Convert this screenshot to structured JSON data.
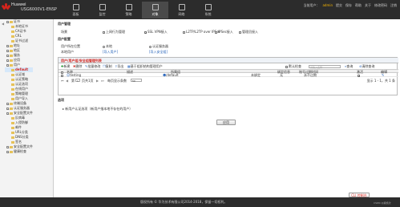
{
  "header": {
    "brand": "Huawei",
    "model": "USG6000V1-ENSP",
    "nav": [
      {
        "label": "面板",
        "icon": "dashboard-icon"
      },
      {
        "label": "监控",
        "icon": "monitor-icon"
      },
      {
        "label": "策略",
        "icon": "policy-icon"
      },
      {
        "label": "对象",
        "icon": "object-icon",
        "active": true
      },
      {
        "label": "网络",
        "icon": "network-icon"
      },
      {
        "label": "系统",
        "icon": "system-icon"
      }
    ],
    "top_links": [
      "当前用户：",
      "admin",
      "提交",
      "保存",
      "帮助",
      "关于",
      "修改密码",
      "注销"
    ]
  },
  "sidebar": {
    "items": [
      {
        "label": "证书",
        "indent": 0
      },
      {
        "label": "本地证书",
        "indent": 1
      },
      {
        "label": "CA证书",
        "indent": 1
      },
      {
        "label": "CRL",
        "indent": 1
      },
      {
        "label": "证书过滤",
        "indent": 1
      },
      {
        "label": "地址",
        "indent": 0
      },
      {
        "label": "地区",
        "indent": 0
      },
      {
        "label": "服务",
        "indent": 0
      },
      {
        "label": "应用",
        "indent": 0
      },
      {
        "label": "用户",
        "indent": 0
      },
      {
        "label": "default",
        "indent": 1,
        "selected": true
      },
      {
        "label": "认证域",
        "indent": 1
      },
      {
        "label": "认证策略",
        "indent": 1
      },
      {
        "label": "认证选项",
        "indent": 1
      },
      {
        "label": "在线用户",
        "indent": 1
      },
      {
        "label": "策略管理",
        "indent": 1
      },
      {
        "label": "用户导入",
        "indent": 1
      },
      {
        "label": "终端设备",
        "indent": 0
      },
      {
        "label": "认证服务器",
        "indent": 0
      },
      {
        "label": "安全配置文件",
        "indent": 0
      },
      {
        "label": "反病毒",
        "indent": 1
      },
      {
        "label": "入侵防御",
        "indent": 1
      },
      {
        "label": "邮件",
        "indent": 1
      },
      {
        "label": "URL分类",
        "indent": 1
      },
      {
        "label": "DNS分类",
        "indent": 1
      },
      {
        "label": "签名",
        "indent": 1
      },
      {
        "label": "安全配置文件",
        "indent": 0
      },
      {
        "label": "健康检查",
        "indent": 0
      }
    ]
  },
  "main": {
    "user_mgmt_title": "用户管理",
    "scenario_label": "场景",
    "scenario_options": [
      {
        "label": "上网行为管理",
        "checked": false
      },
      {
        "label": "SSL VPN接入",
        "checked": true
      },
      {
        "label": "L2TP/L2TP over IPSec",
        "checked": false
      },
      {
        "label": "IPSec接入",
        "checked": false
      },
      {
        "label": "管理员接入",
        "checked": false
      }
    ],
    "user_config_title": "用户配置",
    "user_location_label": "用户所在位置",
    "user_location_options": [
      {
        "label": "本地",
        "on": true
      },
      {
        "label": "认证服务器",
        "on": false
      }
    ],
    "local_user_label": "本地用户",
    "import_user_link": "[导入用户]",
    "import_cert_link": "[导入安全组]",
    "grid_title": "用户/用户组/安全组管理列表",
    "toolbar": {
      "new": "新建",
      "delete": "删除",
      "batch": "批量修改",
      "copy": "复制",
      "export": "导出",
      "preview": "基于组织结构管理用户"
    },
    "search_checkbox_label": "默认检查",
    "search_placeholder": "请输入名称",
    "search_btn": "查询",
    "clear_btn": "清除查询",
    "columns": [
      "名称",
      "描述",
      "所属组",
      "绑定信息",
      "账号过期时间",
      "激活",
      "编辑"
    ],
    "rows": [
      {
        "name": "testing",
        "desc": "",
        "group": "/default",
        "bind": "未绑定",
        "bind_info": "无",
        "expire": "永不过期",
        "active": true
      }
    ],
    "pager": {
      "page_label": "第",
      "page": "1",
      "of_label": "页共1页",
      "per_page_label": "每页显示条数",
      "per_page": "50",
      "summary": "显示 1 - 1，共 1 条"
    },
    "options_title": "选项",
    "option_item": "新用户认证选项（新用户指本地不存在的用户）",
    "apply_btn": "应用"
  },
  "footer": {
    "copyright": "版权所有 © 华为技术有限公司2014-2018，保留一切权利。",
    "cli_btn": "CLI 控制台",
    "watermark": "CSDN @梁凯欣"
  }
}
